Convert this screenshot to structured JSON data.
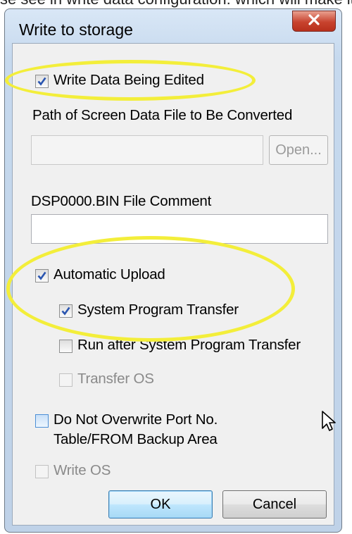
{
  "top_strip_text": "se see in write data configuration: which will make it then",
  "dialog": {
    "title": "Write to storage",
    "write_data_being_edited": {
      "label": "Write Data Being Edited",
      "checked": true
    },
    "path_label": "Path of Screen Data File to Be Converted",
    "path_value": "",
    "open_button": "Open...",
    "comment_label": "DSP0000.BIN File Comment",
    "comment_value": "",
    "automatic_upload": {
      "label": "Automatic Upload",
      "checked": true
    },
    "system_program_transfer": {
      "label": "System Program Transfer",
      "checked": true
    },
    "run_after_transfer": {
      "label": "Run after System Program Transfer",
      "checked": false
    },
    "transfer_os": {
      "label": "Transfer OS",
      "checked": false
    },
    "do_not_overwrite": {
      "line1": "Do Not Overwrite Port No.",
      "line2": "Table/FROM Backup Area",
      "checked": false
    },
    "write_os": {
      "label": "Write OS",
      "checked": false
    },
    "ok_button": "OK",
    "cancel_button": "Cancel"
  },
  "colors": {
    "highlight": "#f3ee3a",
    "check_mark": "#2a55b0"
  }
}
